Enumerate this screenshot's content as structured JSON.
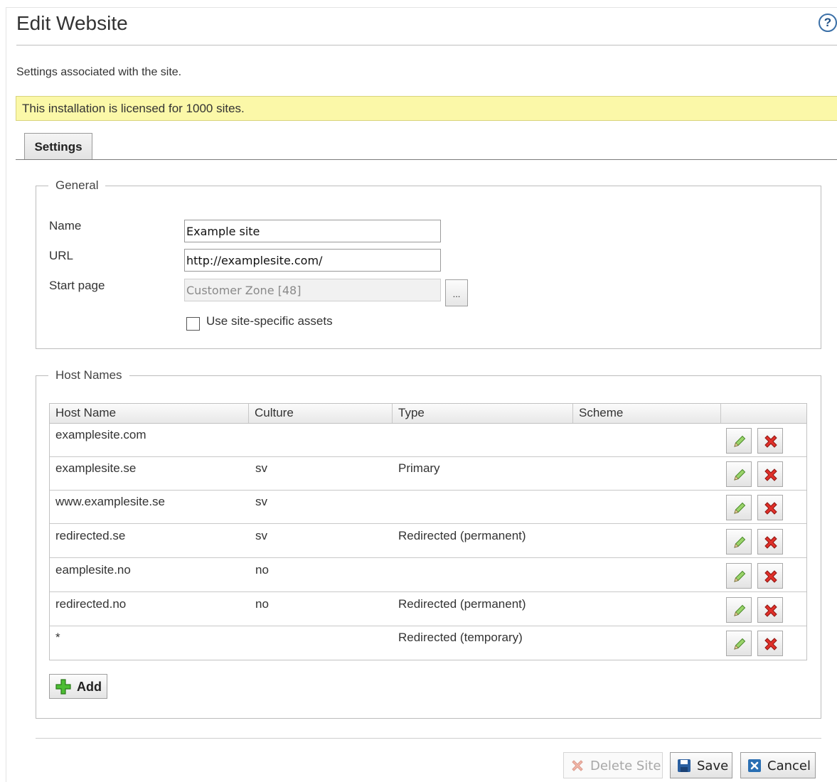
{
  "page": {
    "title": "Edit Website",
    "help_icon": "?",
    "description": "Settings associated with the site.",
    "license_notice": "This installation is licensed for 1000 sites."
  },
  "tabs": [
    {
      "label": "Settings",
      "active": true
    }
  ],
  "general": {
    "legend": "General",
    "name_label": "Name",
    "name_value": "Example site",
    "url_label": "URL",
    "url_value": "http://examplesite.com/",
    "start_page_label": "Start page",
    "start_page_value": "Customer Zone [48]",
    "browse_label": "...",
    "assets_checkbox_label": "Use site-specific assets",
    "assets_checked": false
  },
  "host_names": {
    "legend": "Host Names",
    "columns": [
      "Host Name",
      "Culture",
      "Type",
      "Scheme"
    ],
    "rows": [
      {
        "host": "examplesite.com",
        "culture": "",
        "type": "",
        "scheme": ""
      },
      {
        "host": "examplesite.se",
        "culture": "sv",
        "type": "Primary",
        "scheme": ""
      },
      {
        "host": "www.examplesite.se",
        "culture": "sv",
        "type": "",
        "scheme": ""
      },
      {
        "host": "redirected.se",
        "culture": "sv",
        "type": "Redirected (permanent)",
        "scheme": ""
      },
      {
        "host": "eamplesite.no",
        "culture": "no",
        "type": "",
        "scheme": ""
      },
      {
        "host": "redirected.no",
        "culture": "no",
        "type": "Redirected (permanent)",
        "scheme": ""
      },
      {
        "host": "*",
        "culture": "",
        "type": "Redirected (temporary)",
        "scheme": ""
      }
    ],
    "edit_icon": "pencil-icon",
    "delete_icon": "red-x-icon",
    "add_label": "Add",
    "add_icon": "green-plus-icon"
  },
  "footer": {
    "delete_label": "Delete Site",
    "delete_disabled": true,
    "save_label": "Save",
    "cancel_label": "Cancel"
  },
  "colors": {
    "license_bg": "#fbf8a8",
    "accent_blue": "#2a5fa0",
    "delete_red": "#e0302a",
    "add_green": "#3fae2a"
  }
}
